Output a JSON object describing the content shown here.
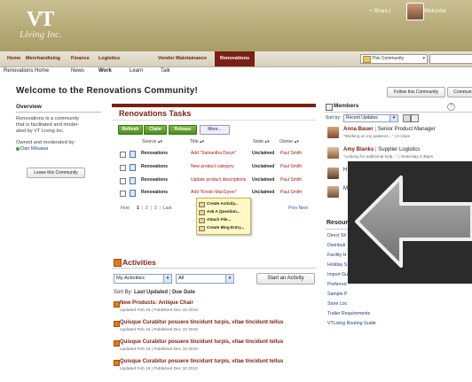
{
  "header": {
    "logo_mark": "VT",
    "logo_text": "Living Inc.",
    "share": "+ Share |",
    "welcome": "Welcome"
  },
  "nav": {
    "items": [
      "Home",
      "Merchandising",
      "Finance",
      "Logistics",
      "Vendor Maintainance",
      "Renovations"
    ],
    "active": "Renovations",
    "community_select": "This Community",
    "community_arrow": "▾"
  },
  "subnav": {
    "items": [
      "Renovations Home",
      "News",
      "Work",
      "Learn",
      "Talk"
    ],
    "active": "Work"
  },
  "page": {
    "title": "Welcome to the Renovations Community!",
    "follow_button": "Follow this Community",
    "community_button": "Communi"
  },
  "overview": {
    "title": "Overview",
    "description_lines": [
      "Renovations is a community",
      "that is facilitated and moder-",
      "ated by VT Living Inc."
    ],
    "owned_label": "Owned and moderated by:",
    "owner": "Dan Misawa",
    "leave_button": "Leave this Community"
  },
  "tasks": {
    "title": "Renovations Tasks",
    "buttons": {
      "refresh": "Refresh",
      "claim": "Claim",
      "release": "Release",
      "more": "More..."
    },
    "columns": [
      "Source ▴▾",
      "Title ▴▾",
      "State ▴▾",
      "Owner ▴▾"
    ],
    "rows": [
      {
        "source": "Renovations",
        "title": "Add \"Samantha Daryn\"",
        "state": "Unclaimed",
        "owner": "Paul Smith"
      },
      {
        "source": "Renovations",
        "title": "New product category",
        "state": "Unclaimed",
        "owner": "Paul Smith"
      },
      {
        "source": "Renovations",
        "title": "Update product descriptions",
        "state": "Unclaimed",
        "owner": "Paul Smith"
      },
      {
        "source": "Renovations",
        "title": "Add \"Kristin MacGyver\"",
        "state": "Unclaimed",
        "owner": "Paul Smith"
      }
    ],
    "pager": {
      "first": "First",
      "pages": [
        "1",
        "2",
        "3"
      ],
      "separator": "|",
      "last": "Last",
      "prev_next": "Prev Next"
    },
    "context_menu": [
      "Create Activity...",
      "Ask A Question...",
      "Attach File...",
      "Create Blog Entry..."
    ]
  },
  "activities": {
    "title": "Activities",
    "filter1": "My Activities",
    "filter2": "All",
    "start_button": "Start an Activity",
    "sort_label": "Sort By:",
    "sort_last_updated": "Last Updated",
    "sort_sep": "|",
    "sort_due_date": "Due Date",
    "items": [
      {
        "title": "New Products: Antique Chair",
        "meta": "Updated Feb 15  |  Published Dec 10 2010"
      },
      {
        "title": "Quisque Curabitur posuere tincidunt turpis, vitae tincidunt tellus",
        "meta": "Updated Feb 15  |  Published Dec 10 2010"
      },
      {
        "title": "Quisque Curabitur posuere tincidunt turpis, vitae tincidunt tellus",
        "meta": "Updated Feb 15  |  Published Dec 10 2010"
      },
      {
        "title": "Quisque Curabitur posuere tincidunt turpis, vitae tincidunt tellus",
        "meta": "Updated Feb 15  |  Published Dec 10 2010"
      }
    ]
  },
  "members": {
    "title": "Members",
    "help": "?",
    "sort_label": "Sort by:",
    "sort_value": "Recent Updates",
    "list": [
      {
        "name": "Anna Bauer",
        "role": "Senior Product Manager",
        "status": "\"Working on my patience...\" | 9:13am"
      },
      {
        "name": "Amy Blanks",
        "role": "Supplier Logistics",
        "status": "\"Looking for additional help...\" | Yesterday 4:35pm"
      },
      {
        "name": "H",
        "role": "",
        "status": ""
      },
      {
        "name": "M",
        "role": "",
        "status": ""
      }
    ]
  },
  "resources": {
    "title": "Resour",
    "links": [
      "Direct Sh",
      "Distributi",
      "Facility H",
      "Holiday S",
      "Import Gu",
      "Preferred",
      "Sample P",
      "Store Loc",
      "Trailer Requirements",
      "VTLiving Routing Guide"
    ]
  },
  "overlay": {
    "icon": "back-arrow-icon"
  },
  "colors": {
    "brand": "#7a1f15",
    "header_bg": "#b6ab78",
    "action_green": "#5a9a2a",
    "link": "#9b1a10"
  }
}
